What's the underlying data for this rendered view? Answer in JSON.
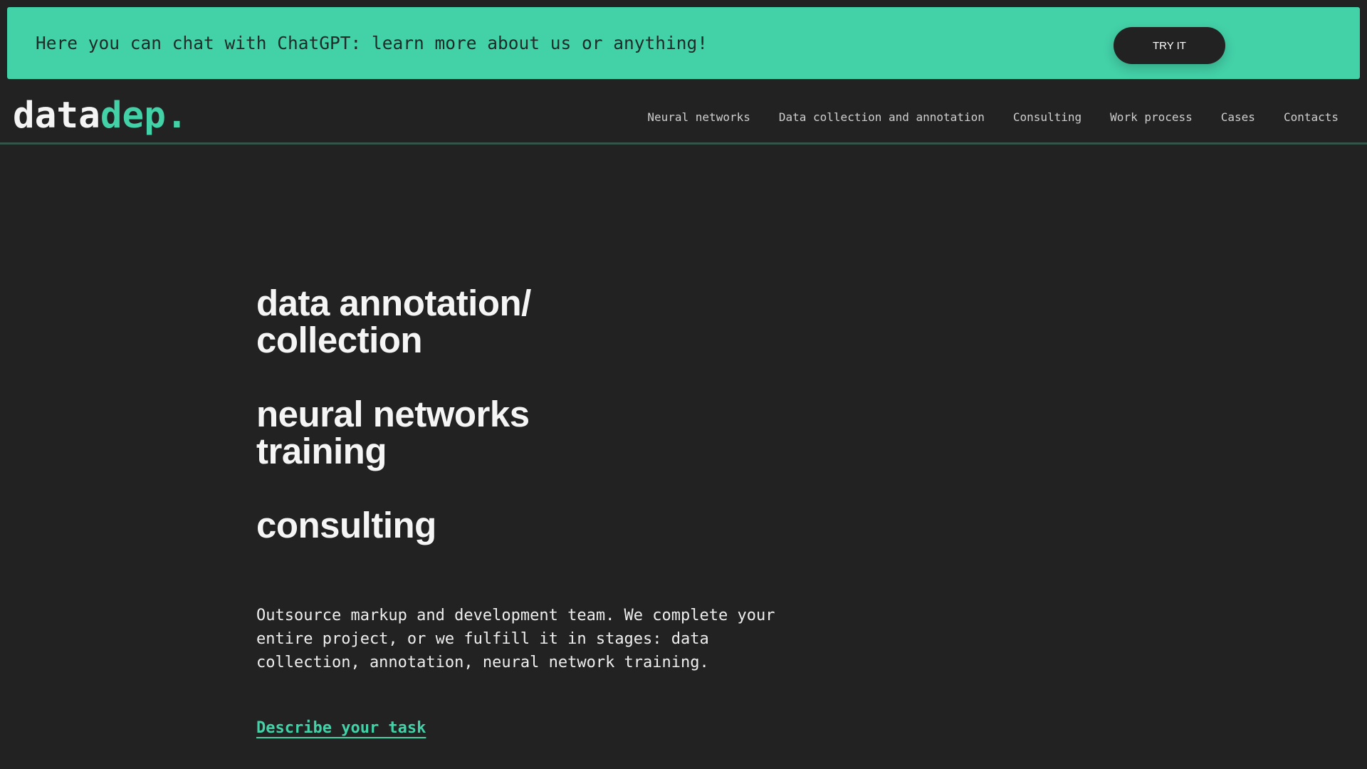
{
  "banner": {
    "text": "Here you can chat with ChatGPT: learn more about us or anything!",
    "button_label": "TRY IT"
  },
  "logo": {
    "part1": "data",
    "part2": "dep."
  },
  "nav": {
    "items": [
      {
        "label": "Neural networks"
      },
      {
        "label": "Data collection and annotation"
      },
      {
        "label": "Consulting"
      },
      {
        "label": "Work process"
      },
      {
        "label": "Cases"
      },
      {
        "label": "Contacts"
      }
    ]
  },
  "hero": {
    "headings": [
      {
        "line1": "data annotation/",
        "line2": "collection"
      },
      {
        "line1": "neural networks",
        "line2": "training"
      },
      {
        "line1": "consulting"
      }
    ],
    "description": "Outsource markup and development team. We complete your entire project, or we fulfill it in stages: data collection, annotation, neural network training.",
    "cta_label": "Describe your task"
  },
  "colors": {
    "accent": "#43d1a8",
    "background": "#222222"
  }
}
